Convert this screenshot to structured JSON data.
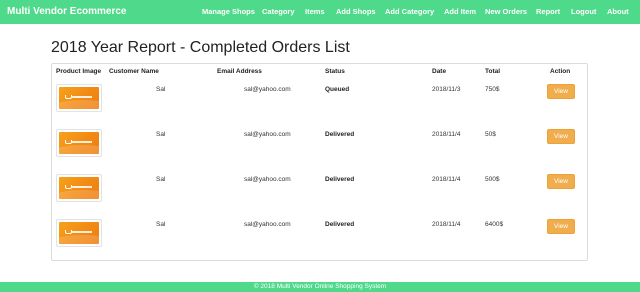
{
  "navbar": {
    "brand": "Multi Vendor Ecommerce",
    "items": [
      "Manage Shops",
      "Category",
      "Items",
      "Add Shops",
      "Add Category",
      "Add Item",
      "New Orders",
      "Report",
      "Logout",
      "About"
    ]
  },
  "page": {
    "title": "2018 Year Report - Completed Orders List"
  },
  "table": {
    "headers": [
      "Product Image",
      "Customer Name",
      "Email Address",
      "Status",
      "Date",
      "Total",
      "Action"
    ],
    "rows": [
      {
        "customer": "Sal",
        "email": "sal@yahoo.com",
        "status": "Queued",
        "date": "2018/11/3",
        "total": "750$",
        "action": "View"
      },
      {
        "customer": "Sal",
        "email": "sal@yahoo.com",
        "status": "Delivered",
        "date": "2018/11/4",
        "total": "50$",
        "action": "View"
      },
      {
        "customer": "Sal",
        "email": "sal@yahoo.com",
        "status": "Delivered",
        "date": "2018/11/4",
        "total": "500$",
        "action": "View"
      },
      {
        "customer": "Sal",
        "email": "sal@yahoo.com",
        "status": "Delivered",
        "date": "2018/11/4",
        "total": "6400$",
        "action": "View"
      }
    ]
  },
  "footer": {
    "text": "© 2018 Multi Vendor Online Shopping System"
  },
  "colors": {
    "nav_bg": "#4fd98a",
    "button_bg": "#f0ad4e",
    "thumb_orange": "#f28a14"
  }
}
